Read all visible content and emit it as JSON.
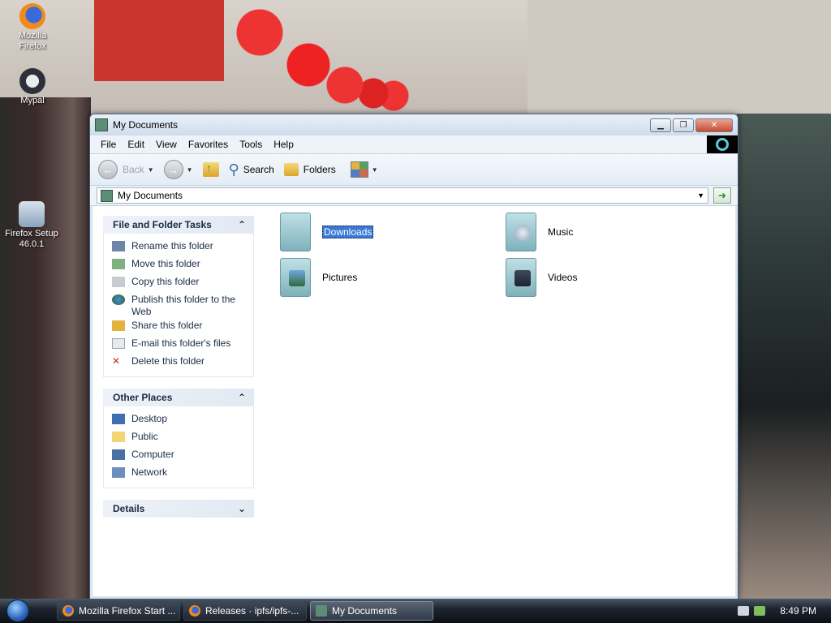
{
  "desktop": {
    "icons": [
      {
        "label": "Mozilla Firefox",
        "icon": "firefox-icon"
      },
      {
        "label": "Mypal",
        "icon": "mypal-icon"
      },
      {
        "label": "Firefox Setup 46.0.1",
        "icon": "setup-icon"
      }
    ]
  },
  "window": {
    "title": "My Documents",
    "menu": [
      "File",
      "Edit",
      "View",
      "Favorites",
      "Tools",
      "Help"
    ],
    "toolbar": {
      "back": "Back",
      "search": "Search",
      "folders": "Folders"
    },
    "address": "My Documents"
  },
  "taskpane": {
    "file_tasks": {
      "title": "File and Folder Tasks",
      "items": [
        "Rename this folder",
        "Move this folder",
        "Copy this folder",
        "Publish this folder to the Web",
        "Share this folder",
        "E-mail this folder's files",
        "Delete this folder"
      ]
    },
    "other_places": {
      "title": "Other Places",
      "items": [
        "Desktop",
        "Public",
        "Computer",
        "Network"
      ]
    },
    "details": {
      "title": "Details"
    }
  },
  "files": [
    {
      "name": "Downloads",
      "selected": true
    },
    {
      "name": "Music",
      "selected": false
    },
    {
      "name": "Pictures",
      "selected": false
    },
    {
      "name": "Videos",
      "selected": false
    }
  ],
  "taskbar": {
    "items": [
      "Mozilla Firefox Start ...",
      "Releases · ipfs/ipfs-...",
      "My Documents"
    ],
    "clock": "8:49 PM"
  },
  "colors": {
    "selection": "#3a78d6",
    "link_text": "#1b2b45"
  }
}
